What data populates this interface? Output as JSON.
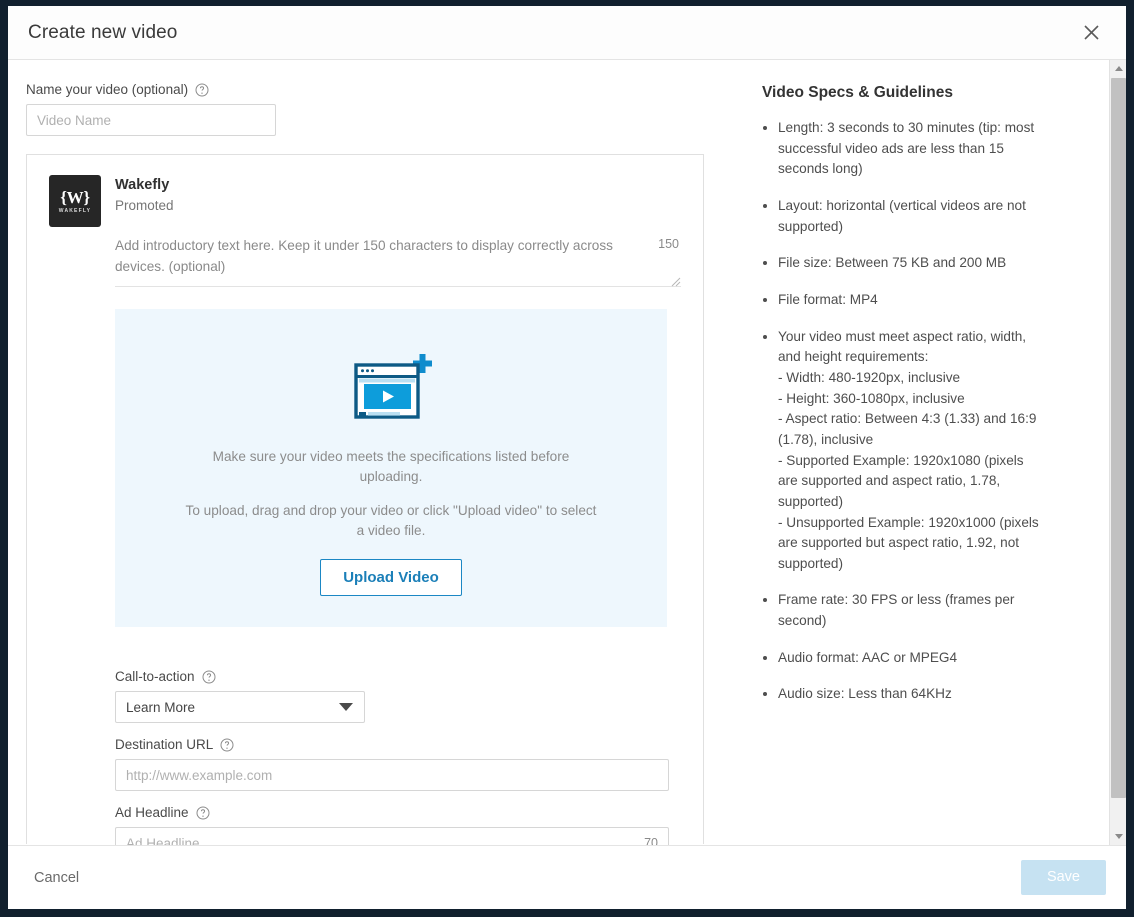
{
  "header": {
    "title": "Create new video",
    "close_icon": "close-icon"
  },
  "form": {
    "video_name": {
      "label": "Name your video (optional)",
      "placeholder": "Video Name",
      "value": "",
      "help_icon": "help-circle-icon"
    },
    "preview": {
      "advertiser_name": "Wakefly",
      "advertiser_status": "Promoted",
      "logo_mark": "{W}",
      "logo_word": "WAKEFLY",
      "intro_placeholder": "Add introductory text here. Keep it under 150 characters to display correctly across devices. (optional)",
      "intro_value": "",
      "intro_counter": "150"
    },
    "dropzone": {
      "icon": "video-upload-icon",
      "line1": "Make sure your video meets the specifications listed before uploading.",
      "line2": "To upload, drag and drop your video or click \"Upload video\" to select a video file.",
      "upload_button": "Upload Video"
    },
    "call_to_action": {
      "label": "Call-to-action",
      "selected": "Learn More",
      "options": [
        "Learn More"
      ],
      "help_icon": "help-circle-icon",
      "caret_icon": "chevron-down-icon"
    },
    "destination_url": {
      "label": "Destination URL",
      "placeholder": "http://www.example.com",
      "value": "",
      "help_icon": "help-circle-icon"
    },
    "ad_headline": {
      "label": "Ad Headline",
      "placeholder": "Ad Headline",
      "value": "",
      "counter": "70",
      "help_icon": "help-circle-icon"
    }
  },
  "specs": {
    "title": "Video Specs & Guidelines",
    "items": [
      {
        "text": "Length: 3 seconds to 30 minutes (tip: most successful video ads are less than 15 seconds long)",
        "sublines": []
      },
      {
        "text": "Layout: horizontal (vertical videos are not supported)",
        "sublines": []
      },
      {
        "text": "File size: Between 75 KB and 200 MB",
        "sublines": []
      },
      {
        "text": "File format: MP4",
        "sublines": []
      },
      {
        "text": "Your video must meet aspect ratio, width, and height requirements:",
        "sublines": [
          "-  Width: 480-1920px, inclusive",
          "-  Height: 360-1080px, inclusive",
          "-  Aspect ratio: Between 4:3 (1.33) and 16:9 (1.78), inclusive",
          "-  Supported Example: 1920x1080 (pixels are supported and aspect ratio, 1.78, supported)",
          "-  Unsupported Example: 1920x1000 (pixels are supported but aspect ratio, 1.92, not supported)"
        ]
      },
      {
        "text": "Frame rate: 30 FPS or less (frames per second)",
        "sublines": []
      },
      {
        "text": "Audio format: AAC or MPEG4",
        "sublines": []
      },
      {
        "text": "Audio size: Less than 64KHz",
        "sublines": []
      }
    ]
  },
  "footer": {
    "cancel_label": "Cancel",
    "save_label": "Save"
  },
  "colors": {
    "accent_blue": "#1b7fb8",
    "dropzone_bg": "#eef7fd",
    "save_disabled": "#c6e2f2",
    "logo_bg": "#262626"
  }
}
